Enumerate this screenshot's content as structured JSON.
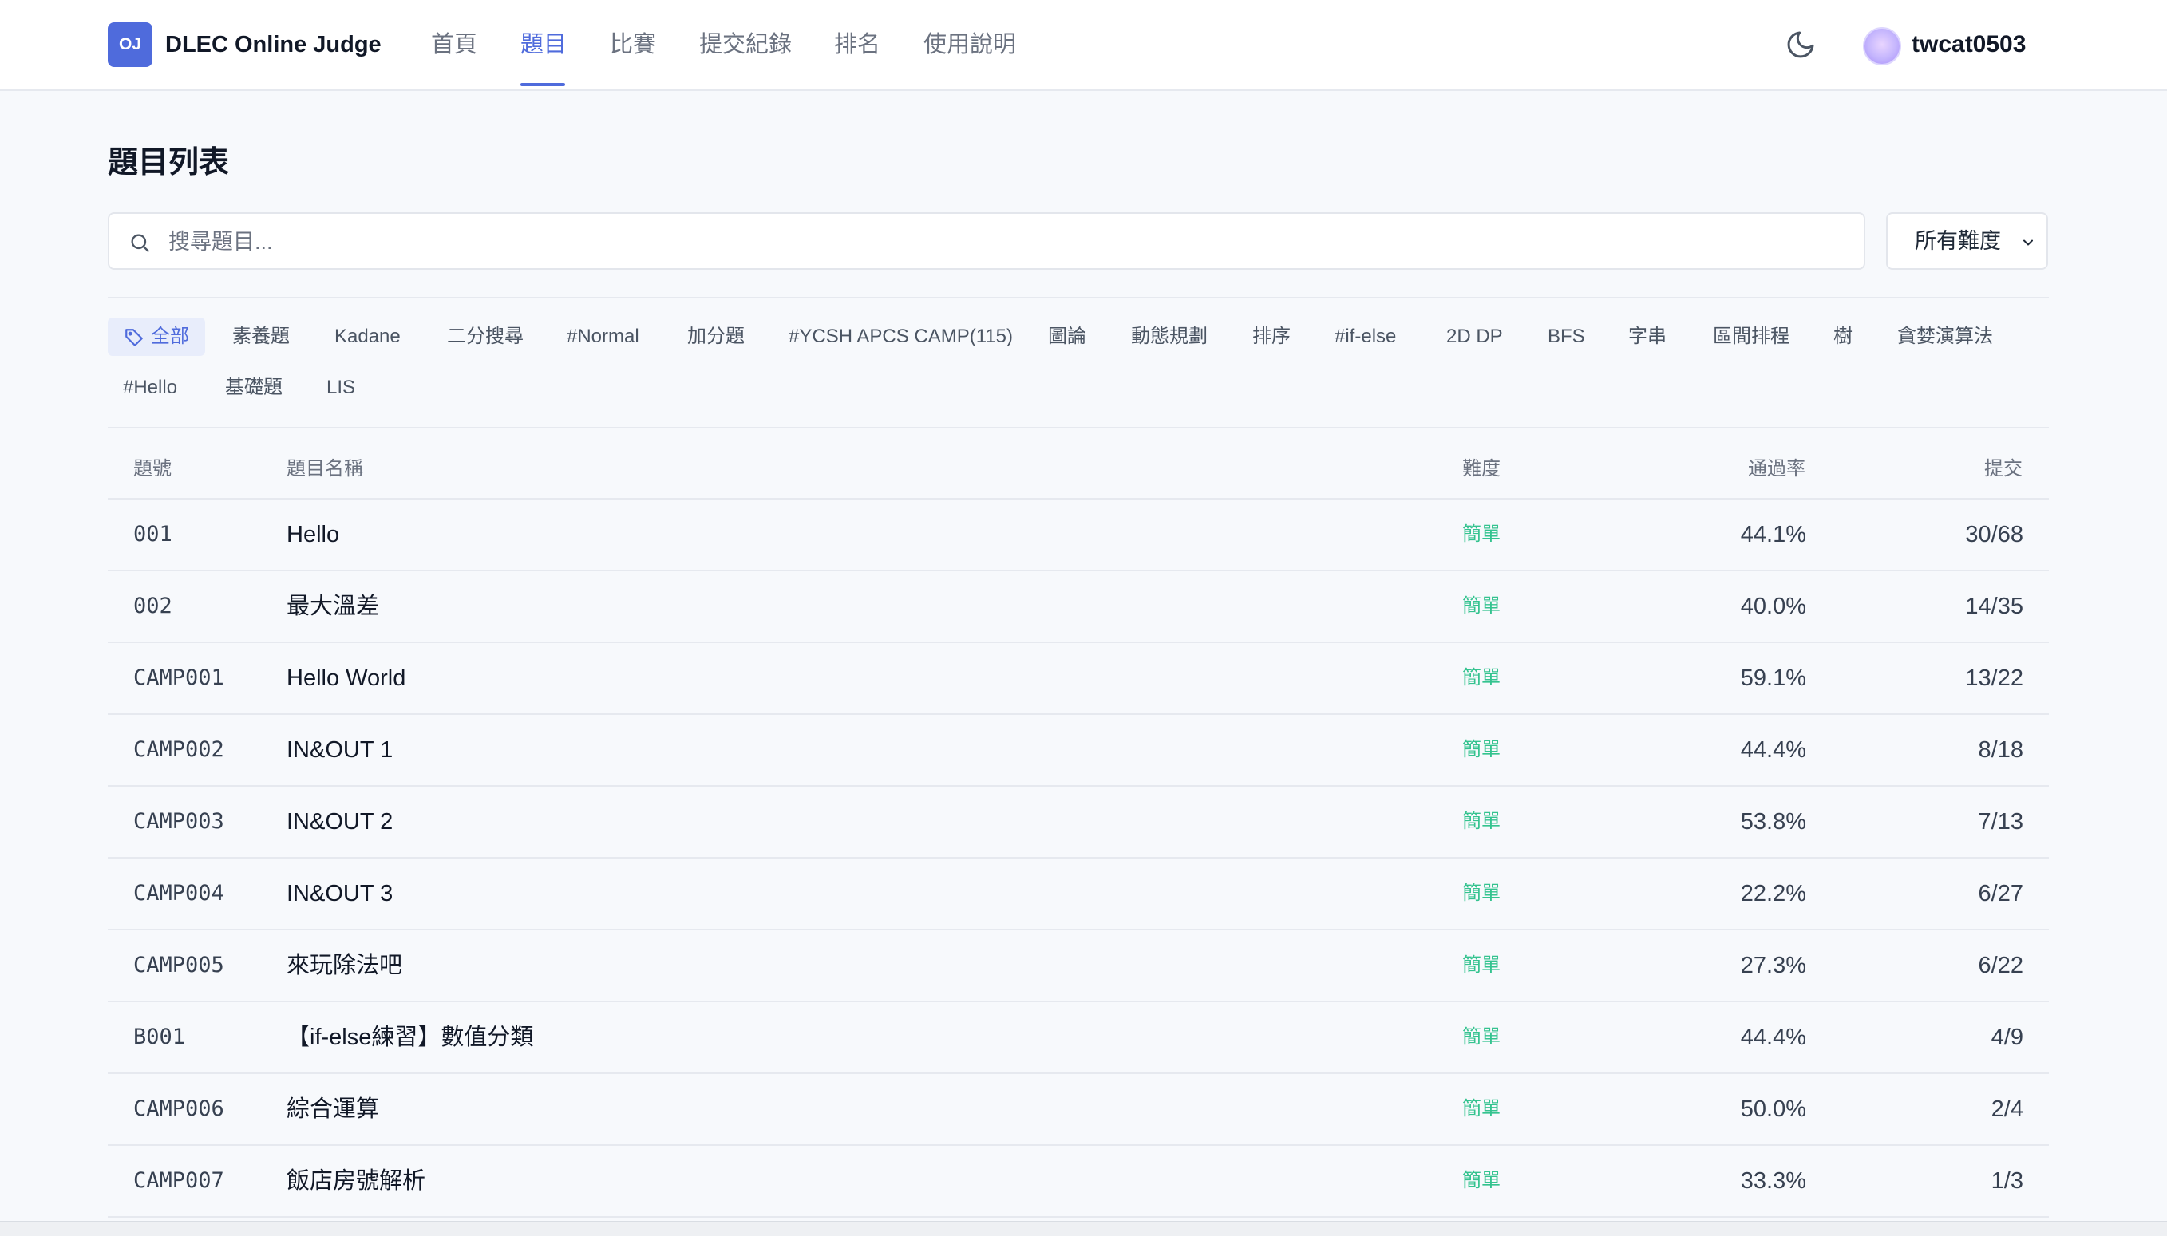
{
  "header": {
    "logo_text": "OJ",
    "brand": "DLEC Online Judge",
    "nav": [
      {
        "label": "首頁",
        "active": false
      },
      {
        "label": "題目",
        "active": true
      },
      {
        "label": "比賽",
        "active": false
      },
      {
        "label": "提交紀錄",
        "active": false
      },
      {
        "label": "排名",
        "active": false
      },
      {
        "label": "使用說明",
        "active": false
      }
    ],
    "username": "twcat0503"
  },
  "page": {
    "title": "題目列表",
    "search_placeholder": "搜尋題目...",
    "difficulty_filter": "所有難度"
  },
  "tags": [
    "全部",
    "素養題",
    "Kadane",
    "二分搜尋",
    "#Normal",
    "加分題",
    "#YCSH APCS CAMP(115)",
    "圖論",
    "動態規劃",
    "排序",
    "#if-else",
    "2D DP",
    "BFS",
    "字串",
    "區間排程",
    "樹",
    "貪婪演算法",
    "#Hello",
    "基礎題",
    "LIS"
  ],
  "table": {
    "headers": {
      "id": "題號",
      "name": "題目名稱",
      "difficulty": "難度",
      "rate": "通過率",
      "submissions": "提交"
    },
    "rows": [
      {
        "id": "001",
        "name": "Hello",
        "difficulty": "簡單",
        "rate": "44.1%",
        "submissions": "30/68"
      },
      {
        "id": "002",
        "name": "最大溫差",
        "difficulty": "簡單",
        "rate": "40.0%",
        "submissions": "14/35"
      },
      {
        "id": "CAMP001",
        "name": "Hello World",
        "difficulty": "簡單",
        "rate": "59.1%",
        "submissions": "13/22"
      },
      {
        "id": "CAMP002",
        "name": "IN&OUT 1",
        "difficulty": "簡單",
        "rate": "44.4%",
        "submissions": "8/18"
      },
      {
        "id": "CAMP003",
        "name": "IN&OUT 2",
        "difficulty": "簡單",
        "rate": "53.8%",
        "submissions": "7/13"
      },
      {
        "id": "CAMP004",
        "name": "IN&OUT 3",
        "difficulty": "簡單",
        "rate": "22.2%",
        "submissions": "6/27"
      },
      {
        "id": "CAMP005",
        "name": "來玩除法吧",
        "difficulty": "簡單",
        "rate": "27.3%",
        "submissions": "6/22"
      },
      {
        "id": "B001",
        "name": "【if-else練習】數值分類",
        "difficulty": "簡單",
        "rate": "44.4%",
        "submissions": "4/9"
      },
      {
        "id": "CAMP006",
        "name": "綜合運算",
        "difficulty": "簡單",
        "rate": "50.0%",
        "submissions": "2/4"
      },
      {
        "id": "CAMP007",
        "name": "飯店房號解析",
        "difficulty": "簡單",
        "rate": "33.3%",
        "submissions": "1/3"
      }
    ]
  },
  "colors": {
    "accent": "#4f6bdc",
    "easy": "#34c38f",
    "background": "#f7f9fc"
  },
  "icons": {
    "theme": "moon-icon",
    "search": "search-icon",
    "tag": "tag-icon",
    "dropdown": "chevron-down-icon"
  }
}
